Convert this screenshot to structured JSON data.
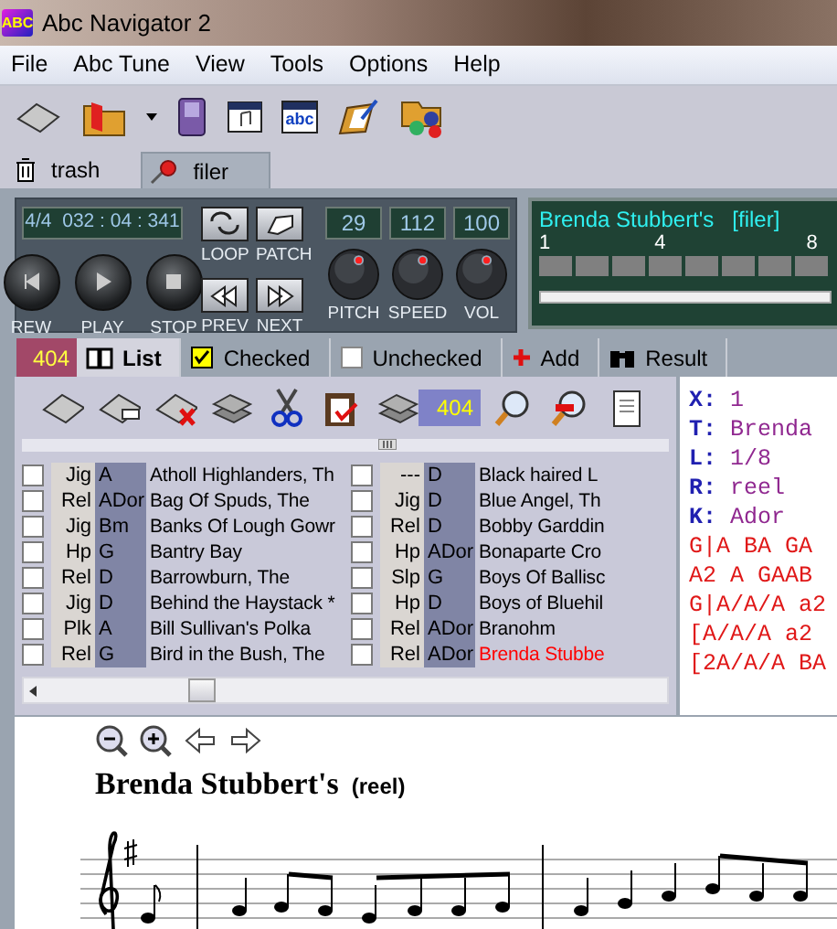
{
  "window": {
    "title": "Abc Navigator 2",
    "app_icon_text": "ABC"
  },
  "menu": [
    "File",
    "Abc Tune",
    "View",
    "Tools",
    "Options",
    "Help"
  ],
  "toolbar": {
    "abc_icon_text": "abc"
  },
  "doc_tabs": [
    {
      "label": "trash",
      "selected": false
    },
    {
      "label": "filer",
      "selected": true
    }
  ],
  "player": {
    "time": "4/4  032 : 04 : 341",
    "transport": [
      {
        "label": "REW",
        "kind": "rew"
      },
      {
        "label": "PLAY",
        "kind": "play"
      },
      {
        "label": "STOP",
        "kind": "stop"
      }
    ],
    "small_buttons": [
      {
        "label": "LOOP",
        "kind": "loop"
      },
      {
        "label": "PATCH",
        "kind": "patch"
      },
      {
        "label": "PREV",
        "kind": "prev"
      },
      {
        "label": "NEXT",
        "kind": "next"
      }
    ],
    "knobs": [
      {
        "label": "PITCH",
        "reading": "29"
      },
      {
        "label": "SPEED",
        "reading": "112"
      },
      {
        "label": "VOL",
        "reading": "100"
      }
    ],
    "track": {
      "title": "Brenda Stubbert's   [filer]",
      "measures": [
        "1",
        "4",
        "8"
      ]
    }
  },
  "list_tabs": {
    "count": "404",
    "tabs": [
      {
        "label": "List",
        "kind": "list",
        "selected": true
      },
      {
        "label": "Checked",
        "kind": "checked",
        "selected": false
      },
      {
        "label": "Unchecked",
        "kind": "unchecked",
        "selected": false
      },
      {
        "label": "Add",
        "kind": "add",
        "selected": false
      },
      {
        "label": "Result",
        "kind": "result",
        "selected": false
      }
    ]
  },
  "list_toolbar": {
    "count": "404"
  },
  "tunes": [
    {
      "checked": false,
      "type": "Jig",
      "key": "A",
      "name": "Atholl Highlanders, Th",
      "current": false
    },
    {
      "checked": false,
      "type": "Rel",
      "key": "ADor",
      "name": "Bag Of Spuds, The",
      "current": false
    },
    {
      "checked": false,
      "type": "Jig",
      "key": "Bm",
      "name": "Banks Of Lough Gowr",
      "current": false
    },
    {
      "checked": false,
      "type": "Hp",
      "key": "G",
      "name": "Bantry Bay",
      "current": false
    },
    {
      "checked": false,
      "type": "Rel",
      "key": "D",
      "name": "Barrowburn, The",
      "current": false
    },
    {
      "checked": false,
      "type": "Jig",
      "key": "D",
      "name": "Behind the Haystack *",
      "current": false
    },
    {
      "checked": false,
      "type": "Plk",
      "key": "A",
      "name": "Bill Sullivan's Polka",
      "current": false
    },
    {
      "checked": false,
      "type": "Rel",
      "key": "G",
      "name": "Bird in the Bush, The",
      "current": false
    },
    {
      "checked": false,
      "type": "---",
      "key": "D",
      "name": "Black haired L",
      "current": false
    },
    {
      "checked": false,
      "type": "Jig",
      "key": "D",
      "name": "Blue Angel, Th",
      "current": false
    },
    {
      "checked": false,
      "type": "Rel",
      "key": "D",
      "name": "Bobby Garddin",
      "current": false
    },
    {
      "checked": false,
      "type": "Hp",
      "key": "ADor",
      "name": "Bonaparte Cro",
      "current": false
    },
    {
      "checked": false,
      "type": "Slp",
      "key": "G",
      "name": "Boys Of Ballisc",
      "current": false
    },
    {
      "checked": false,
      "type": "Hp",
      "key": "D",
      "name": "Boys of Bluehil",
      "current": false
    },
    {
      "checked": false,
      "type": "Rel",
      "key": "ADor",
      "name": "Branohm",
      "current": false
    },
    {
      "checked": false,
      "type": "Rel",
      "key": "ADor",
      "name": "Brenda Stubbe",
      "current": true
    }
  ],
  "abc_source": [
    {
      "kind": "header",
      "field": "X:",
      "value": "1"
    },
    {
      "kind": "header",
      "field": "T:",
      "value": "Brenda"
    },
    {
      "kind": "header",
      "field": "L:",
      "value": "1/8"
    },
    {
      "kind": "header",
      "field": "R:",
      "value": "reel"
    },
    {
      "kind": "header",
      "field": "K:",
      "value": "Ador"
    },
    {
      "kind": "music",
      "text": "G|A BA GA"
    },
    {
      "kind": "music",
      "text": "A2 A GAAB"
    },
    {
      "kind": "music",
      "text": "G|A/A/A a2"
    },
    {
      "kind": "music",
      "text": "[A/A/A a2"
    },
    {
      "kind": "music",
      "text": "[2A/A/A BA"
    }
  ],
  "score": {
    "title": "Brenda Stubbert's",
    "rhythm": "(reel)"
  }
}
